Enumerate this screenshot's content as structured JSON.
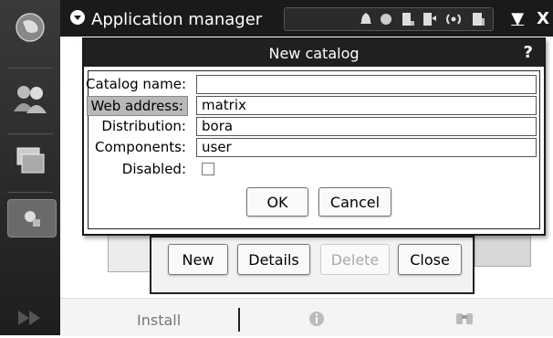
{
  "titlebar": {
    "title": "Application manager",
    "menu_icon": "chevron-down-icon",
    "status_icons": [
      "bell-icon",
      "presence-icon",
      "battery-icon",
      "connectivity-icon",
      "wireless-icon",
      "signal-icon"
    ],
    "minimize": "▼",
    "close": "X"
  },
  "navigator": {
    "items": [
      "web-browser-icon",
      "contacts-icon",
      "applications-icon",
      "app-manager-icon",
      "expand-icon"
    ]
  },
  "dialog": {
    "title": "New catalog",
    "help": "?",
    "fields": {
      "catalog_name": {
        "label": "Catalog name:",
        "value": ""
      },
      "web_address": {
        "label": "Web address:",
        "value": "matrix"
      },
      "distribution": {
        "label": "Distribution:",
        "value": "bora"
      },
      "components": {
        "label": "Components:",
        "value": "user"
      },
      "disabled": {
        "label": "Disabled:",
        "checked": false
      }
    },
    "ok_label": "OK",
    "cancel_label": "Cancel"
  },
  "background_dialog": {
    "new_label": "New",
    "details_label": "Details",
    "delete_label": "Delete",
    "close_label": "Close"
  },
  "toolbar": {
    "install_label": "Install",
    "info_icon": "info-icon",
    "search_icon": "binoculars-icon"
  }
}
